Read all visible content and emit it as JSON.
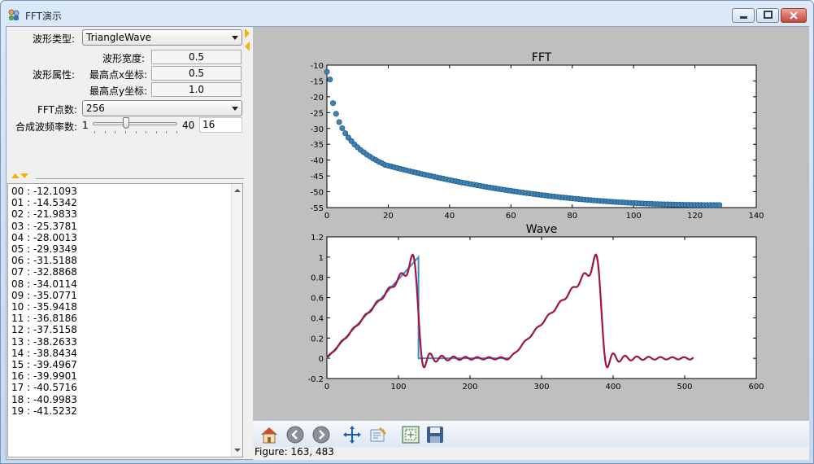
{
  "window": {
    "title": "FFT演示"
  },
  "controls": {
    "wave_type_label": "波形类型:",
    "wave_type_value": "TriangleWave",
    "wave_props_label": "波形属性:",
    "width_label": "波形宽度:",
    "width_value": "0.5",
    "peak_x_label": "最高点x坐标:",
    "peak_x_value": "0.5",
    "peak_y_label": "最高点y坐标:",
    "peak_y_value": "1.0",
    "fft_points_label": "FFT点数:",
    "fft_points_value": "256",
    "freq_count_label": "合成波频率数:",
    "slider_min": "1",
    "slider_max": "40",
    "slider_value": 16,
    "freq_count_value": "16"
  },
  "list": {
    "items": [
      "00 : -12.1093",
      "01 : -14.5342",
      "02 : -21.9833",
      "03 : -25.3781",
      "04 : -28.0013",
      "05 : -29.9349",
      "06 : -31.5188",
      "07 : -32.8868",
      "08 : -34.0114",
      "09 : -35.0771",
      "10 : -35.9418",
      "11 : -36.8186",
      "12 : -37.5158",
      "13 : -38.2633",
      "14 : -38.8434",
      "15 : -39.4967",
      "16 : -39.9901",
      "17 : -40.5716",
      "18 : -40.9983",
      "19 : -41.5232"
    ]
  },
  "toolbar": {
    "icons": [
      "home-icon",
      "back-icon",
      "forward-icon",
      "pan-icon",
      "subplot-config-icon",
      "zoom-rect-icon",
      "save-icon"
    ]
  },
  "status": {
    "text": "Figure: 163, 483"
  },
  "colors": {
    "scatter": "#3c83b6",
    "wave_original": "#3a8bd0",
    "wave_synth": "#a0153e",
    "figure_bg": "#bfbfbf"
  },
  "chart_data": [
    {
      "type": "scatter",
      "title": "FFT",
      "xlabel": "",
      "ylabel": "",
      "xlim": [
        0,
        140
      ],
      "ylim": [
        -55,
        -10
      ],
      "xticks": [
        0,
        20,
        40,
        60,
        80,
        100,
        120,
        140
      ],
      "yticks": [
        -55,
        -50,
        -45,
        -40,
        -35,
        -30,
        -25,
        -20,
        -15,
        -10
      ],
      "x_range": [
        0,
        128
      ],
      "values_first": [
        -12.1093,
        -14.5342,
        -21.9833,
        -25.3781,
        -28.0013,
        -29.9349,
        -31.5188,
        -32.8868,
        -34.0114,
        -35.0771,
        -35.9418,
        -36.8186,
        -37.5158,
        -38.2633,
        -38.8434,
        -39.4967,
        -39.9901,
        -40.5716,
        -40.9983,
        -41.5232
      ],
      "value_end_approx": -54.2
    },
    {
      "type": "line",
      "title": "Wave",
      "xlabel": "",
      "ylabel": "",
      "xlim": [
        0,
        600
      ],
      "ylim": [
        -0.2,
        1.2
      ],
      "xticks": [
        0,
        100,
        200,
        300,
        400,
        500,
        600
      ],
      "yticks": [
        -0.2,
        0.0,
        0.2,
        0.4,
        0.6,
        0.8,
        1.0,
        1.2
      ],
      "series": [
        {
          "description": "original triangle wave",
          "points": [
            [
              0,
              0
            ],
            [
              128,
              1
            ],
            [
              128,
              0
            ],
            [
              256,
              0
            ]
          ]
        },
        {
          "description": "synthesized wave",
          "x_range": [
            0,
            512
          ],
          "harmonics": 16
        }
      ]
    }
  ]
}
